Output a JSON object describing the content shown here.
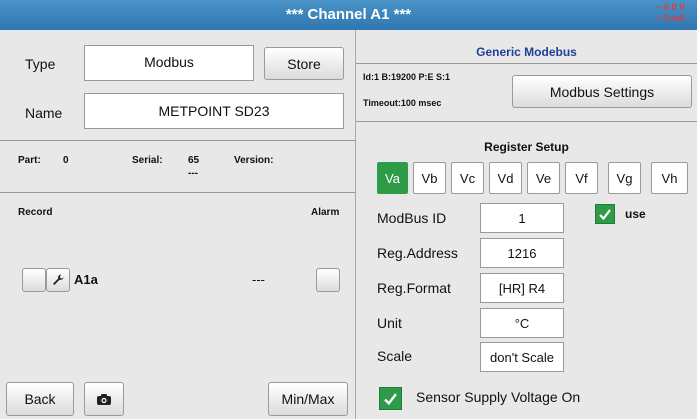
{
  "header": {
    "title": "***   Channel A1   ***",
    "voltage": "~ 0.0 V",
    "current": "~ 0 mA"
  },
  "left": {
    "type_label": "Type",
    "type_value": "Modbus",
    "store_label": "Store",
    "name_label": "Name",
    "name_value": "METPOINT SD23",
    "part_label": "Part:",
    "part_value": "0",
    "serial_label": "Serial:",
    "serial_value": "65",
    "serial_sub": "---",
    "version_label": "Version:",
    "record_label": "Record",
    "alarm_label": "Alarm",
    "channel_label": "A1a",
    "channel_value": "---",
    "back_label": "Back",
    "minmax_label": "Min/Max"
  },
  "right": {
    "generic_title": "Generic Modebus",
    "info_line1": "Id:1 B:19200 P:E S:1",
    "info_line2": "Timeout:100 msec",
    "modbus_settings_label": "Modbus Settings",
    "register_setup_title": "Register Setup",
    "tabs": [
      "Va",
      "Vb",
      "Vc",
      "Vd",
      "Ve",
      "Vf",
      "Vg",
      "Vh"
    ],
    "active_tab": "Va",
    "modbus_id_label": "ModBus ID",
    "modbus_id_value": "1",
    "use_label": "use",
    "reg_address_label": "Reg.Address",
    "reg_address_value": "1216",
    "reg_format_label": "Reg.Format",
    "reg_format_value": "[HR] R4",
    "unit_label": "Unit",
    "unit_value": "°C",
    "scale_label": "Scale",
    "scale_value": "don't Scale",
    "sensor_supply_label": "Sensor Supply Voltage On"
  },
  "colors": {
    "header": "#3a85bd",
    "accent_green": "#2e9b49",
    "title_blue": "#1f3f99",
    "warning_red": "#e23b3b"
  }
}
